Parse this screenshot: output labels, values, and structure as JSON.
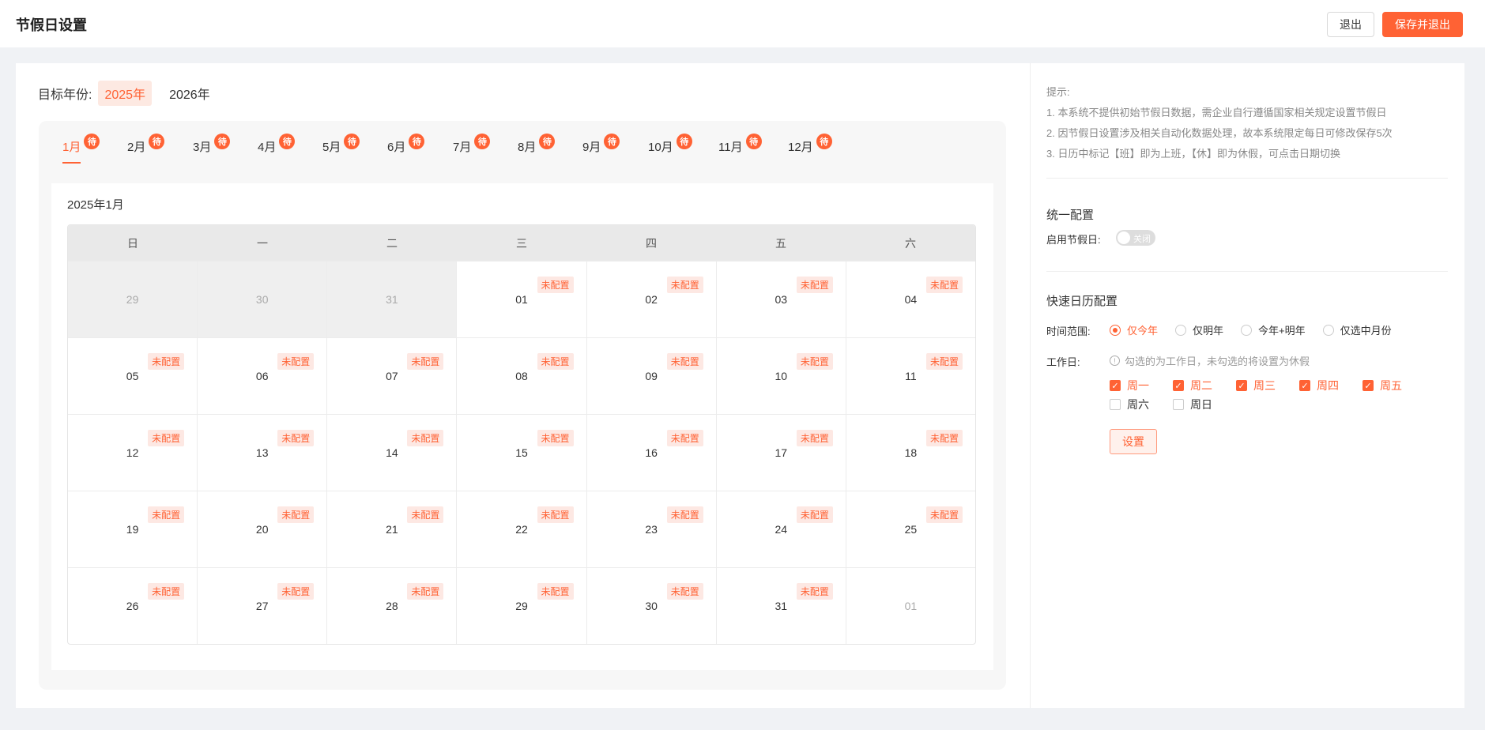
{
  "header": {
    "title": "节假日设置",
    "exit_label": "退出",
    "save_label": "保存并退出"
  },
  "year": {
    "label": "目标年份:",
    "options": [
      "2025年",
      "2026年"
    ],
    "selected": "2025年"
  },
  "months": {
    "badge": "待",
    "items": [
      "1月",
      "2月",
      "3月",
      "4月",
      "5月",
      "6月",
      "7月",
      "8月",
      "9月",
      "10月",
      "11月",
      "12月"
    ],
    "selected": "1月"
  },
  "calendar": {
    "title": "2025年1月",
    "weekdays": [
      "日",
      "一",
      "二",
      "三",
      "四",
      "五",
      "六"
    ],
    "tag": "未配置",
    "weeks": [
      [
        {
          "d": "29",
          "t": "prev"
        },
        {
          "d": "30",
          "t": "prev"
        },
        {
          "d": "31",
          "t": "prev"
        },
        {
          "d": "01",
          "t": "cur"
        },
        {
          "d": "02",
          "t": "cur"
        },
        {
          "d": "03",
          "t": "cur"
        },
        {
          "d": "04",
          "t": "cur"
        }
      ],
      [
        {
          "d": "05",
          "t": "cur"
        },
        {
          "d": "06",
          "t": "cur"
        },
        {
          "d": "07",
          "t": "cur"
        },
        {
          "d": "08",
          "t": "cur"
        },
        {
          "d": "09",
          "t": "cur"
        },
        {
          "d": "10",
          "t": "cur"
        },
        {
          "d": "11",
          "t": "cur"
        }
      ],
      [
        {
          "d": "12",
          "t": "cur"
        },
        {
          "d": "13",
          "t": "cur"
        },
        {
          "d": "14",
          "t": "cur"
        },
        {
          "d": "15",
          "t": "cur"
        },
        {
          "d": "16",
          "t": "cur"
        },
        {
          "d": "17",
          "t": "cur"
        },
        {
          "d": "18",
          "t": "cur"
        }
      ],
      [
        {
          "d": "19",
          "t": "cur"
        },
        {
          "d": "20",
          "t": "cur"
        },
        {
          "d": "21",
          "t": "cur"
        },
        {
          "d": "22",
          "t": "cur"
        },
        {
          "d": "23",
          "t": "cur"
        },
        {
          "d": "24",
          "t": "cur"
        },
        {
          "d": "25",
          "t": "cur"
        }
      ],
      [
        {
          "d": "26",
          "t": "cur"
        },
        {
          "d": "27",
          "t": "cur"
        },
        {
          "d": "28",
          "t": "cur"
        },
        {
          "d": "29",
          "t": "cur"
        },
        {
          "d": "30",
          "t": "cur"
        },
        {
          "d": "31",
          "t": "cur"
        },
        {
          "d": "01",
          "t": "next"
        }
      ]
    ]
  },
  "tips": {
    "title": "提示:",
    "lines": [
      "1. 本系统不提供初始节假日数据，需企业自行遵循国家相关规定设置节假日",
      "2. 因节假日设置涉及相关自动化数据处理，故本系统限定每日可修改保存5次",
      "3. 日历中标记【班】即为上班，【休】即为休假，可点击日期切换"
    ]
  },
  "unified": {
    "title": "统一配置",
    "enable_label": "启用节假日:",
    "switch_text": "关闭"
  },
  "quick": {
    "title": "快速日历配置",
    "range_label": "时间范围:",
    "range_options": [
      "仅今年",
      "仅明年",
      "今年+明年",
      "仅选中月份"
    ],
    "range_selected": "仅今年",
    "workday_label": "工作日:",
    "workday_hint": "勾选的为工作日，未勾选的将设置为休假",
    "days": [
      {
        "label": "周一",
        "checked": true
      },
      {
        "label": "周二",
        "checked": true
      },
      {
        "label": "周三",
        "checked": true
      },
      {
        "label": "周四",
        "checked": true
      },
      {
        "label": "周五",
        "checked": true
      },
      {
        "label": "周六",
        "checked": false
      },
      {
        "label": "周日",
        "checked": false
      }
    ],
    "set_label": "设置"
  },
  "colors": {
    "accent": "#ff6234",
    "accent_light": "#fde8e3"
  }
}
